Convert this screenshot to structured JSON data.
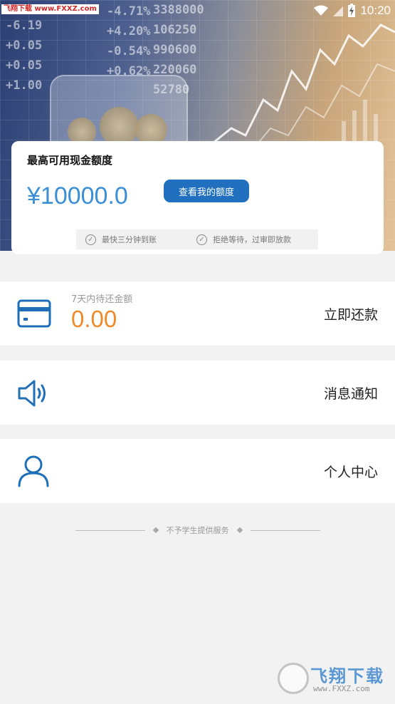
{
  "status_bar": {
    "watermark": "飞翔下载 www.FXXZ.com",
    "time": "10:20"
  },
  "hero": {
    "ticker_left": "-6.19\n+0.05\n+0.05\n+1.00",
    "ticker_mid": "-4.71%\n+4.20%\n-0.54%\n+0.62%",
    "ticker_right": "3388000\n106250\n990600\n220060\n52780"
  },
  "quota_card": {
    "title": "最高可用现金额度",
    "amount": "¥10000.0",
    "button_label": "查看我的额度",
    "features": [
      "最快三分钟到账",
      "拒绝等待，过审即放款"
    ]
  },
  "repay_row": {
    "label": "7天内待还金额",
    "amount": "0.00",
    "action": "立即还款"
  },
  "notice_row": {
    "action": "消息通知"
  },
  "profile_row": {
    "action": "个人中心"
  },
  "footer_note": "不予学生提供服务",
  "watermark_br": {
    "text": "飞翔下载",
    "url": "www.FXXZ.com"
  },
  "colors": {
    "accent_blue": "#2170c0",
    "amount_blue": "#3b8fd6",
    "due_orange": "#ee8a2a"
  },
  "icons": {
    "repay": "credit-card-icon",
    "notice": "speaker-icon",
    "profile": "user-icon"
  }
}
